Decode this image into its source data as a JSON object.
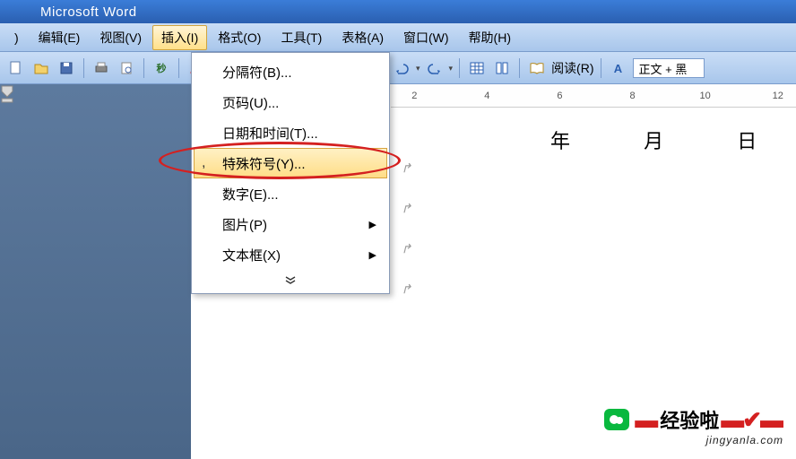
{
  "title": "Microsoft Word",
  "menubar": {
    "file_suffix": ")",
    "edit": "编辑(E)",
    "view": "视图(V)",
    "insert": "插入(I)",
    "format": "格式(O)",
    "tools": "工具(T)",
    "table": "表格(A)",
    "window": "窗口(W)",
    "help": "帮助(H)"
  },
  "dropdown": {
    "break": "分隔符(B)...",
    "pagenum": "页码(U)...",
    "datetime": "日期和时间(T)...",
    "special": "特殊符号(Y)...",
    "number": "数字(E)...",
    "picture": "图片(P)",
    "textbox": "文本框(X)"
  },
  "toolbar": {
    "read": "阅读(R)",
    "style": "正文 + 黑"
  },
  "ruler": {
    "ticks": [
      "2",
      "",
      "4",
      "",
      "6",
      "",
      "8",
      "",
      "10",
      "",
      "12",
      ""
    ]
  },
  "doc": {
    "dateline": "年 月 日"
  },
  "watermark": {
    "text": "经验啦",
    "url": "jingyanla.com"
  }
}
